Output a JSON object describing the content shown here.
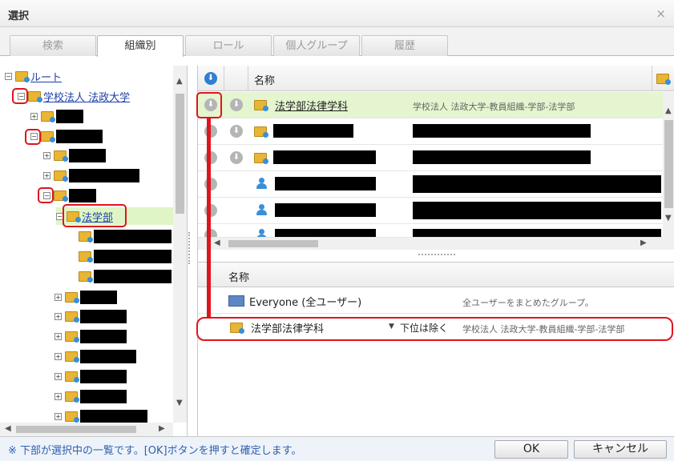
{
  "window": {
    "title": "選択",
    "close_glyph": "×"
  },
  "tabs": [
    {
      "label": "検索",
      "active": false
    },
    {
      "label": "組織別",
      "active": true
    },
    {
      "label": "ロール",
      "active": false
    },
    {
      "label": "個人グループ",
      "active": false
    },
    {
      "label": "履歴",
      "active": false
    }
  ],
  "tree": {
    "root_label": "ルート",
    "org_label": "学校法人 法政大学",
    "faculty_label": "法学部",
    "expander_open": "⊟",
    "expander_closed": "⊞"
  },
  "grid": {
    "header_name": "名称",
    "rows": [
      {
        "name": "法学部法律学科",
        "path": "学校法人 法政大学-教員組織-学部-法学部",
        "selected": true,
        "kind": "group"
      },
      {
        "name": "",
        "path": "",
        "selected": false,
        "kind": "group"
      },
      {
        "name": "",
        "path": "",
        "selected": false,
        "kind": "group"
      },
      {
        "name": "",
        "path": "",
        "selected": false,
        "kind": "user"
      },
      {
        "name": "",
        "path": "",
        "selected": false,
        "kind": "user"
      },
      {
        "name": "",
        "path": "",
        "selected": false,
        "kind": "user"
      }
    ]
  },
  "selected_list": {
    "header_name": "名称",
    "items": [
      {
        "name": "Everyone (全ユーザー)",
        "description": "全ユーザーをまとめたグループ。"
      },
      {
        "name": "法学部法律学科",
        "option": "下位は除く",
        "description": "学校法人 法政大学-教員組織-学部-法学部"
      }
    ]
  },
  "footer": {
    "note": "※ 下部が選択中の一覧です。[OK]ボタンを押すと確定します。",
    "ok_label": "OK",
    "cancel_label": "キャンセル"
  },
  "colors": {
    "accent_red": "#e0141e",
    "selected_row": "#e4f5cf",
    "link_blue": "#1a3fa8"
  }
}
